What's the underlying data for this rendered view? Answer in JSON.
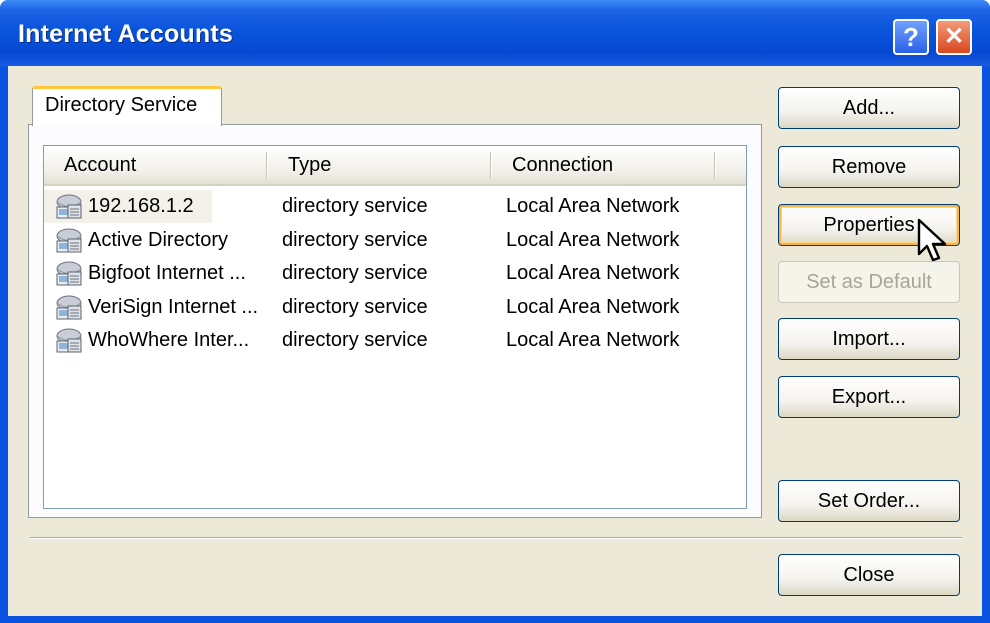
{
  "window": {
    "title": "Internet Accounts"
  },
  "title_buttons": {
    "help": "?",
    "close": "✕"
  },
  "tab": {
    "label": "Directory Service"
  },
  "list": {
    "columns": [
      "Account",
      "Type",
      "Connection"
    ],
    "rows": [
      {
        "account": "192.168.1.2",
        "type": "directory service",
        "connection": "Local Area Network",
        "icon": "directory-service-icon"
      },
      {
        "account": "Active Directory",
        "type": "directory service",
        "connection": "Local Area Network",
        "icon": "directory-service-icon"
      },
      {
        "account": "Bigfoot Internet ...",
        "type": "directory service",
        "connection": "Local Area Network",
        "icon": "directory-service-icon"
      },
      {
        "account": "VeriSign Internet ...",
        "type": "directory service",
        "connection": "Local Area Network",
        "icon": "directory-service-icon"
      },
      {
        "account": "WhoWhere Inter...",
        "type": "directory service",
        "connection": "Local Area Network",
        "icon": "directory-service-icon"
      }
    ]
  },
  "buttons": {
    "add": "Add...",
    "remove": "Remove",
    "properties": "Properties",
    "set_default": "Set as Default",
    "import": "Import...",
    "export": "Export...",
    "set_order": "Set Order...",
    "close": "Close"
  },
  "colors": {
    "titlebar": "#0a54dc",
    "dialog_bg": "#ece9d8",
    "tab_highlight": "#ffc83c"
  }
}
